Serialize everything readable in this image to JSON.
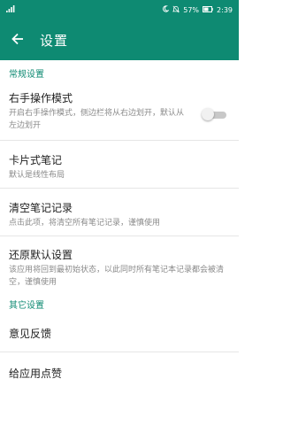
{
  "statusbar": {
    "signal_icon": "signal-icon",
    "moon_icon": "moon-icon",
    "mute_icon": "bell-mute-icon",
    "battery_percent": "57%",
    "battery_icon": "battery-icon",
    "time": "2:39"
  },
  "appbar": {
    "back_icon": "arrow-back-icon",
    "title": "设置"
  },
  "sections": {
    "general": {
      "header": "常规设置"
    },
    "other": {
      "header": "其它设置"
    }
  },
  "items": {
    "right_hand": {
      "title": "右手操作模式",
      "desc": "开启右手操作模式，侧边栏将从右边划开，默认从左边划开",
      "toggle_on": false
    },
    "card_note": {
      "title": "卡片式笔记",
      "desc": "默认是线性布局"
    },
    "clear_notes": {
      "title": "清空笔记记录",
      "desc": "点击此项，将清空所有笔记记录，谨慎使用"
    },
    "restore_default": {
      "title": "还原默认设置",
      "desc": "该应用将回到最初始状态，以此同时所有笔记本记录都会被清空，谨慎使用"
    },
    "feedback": {
      "title": "意见反馈"
    },
    "like_app": {
      "title": "给应用点赞"
    }
  },
  "colors": {
    "primary": "#0e8a72",
    "section_header": "#0e8a72",
    "toggle_track_off": "#c8c8c8"
  }
}
